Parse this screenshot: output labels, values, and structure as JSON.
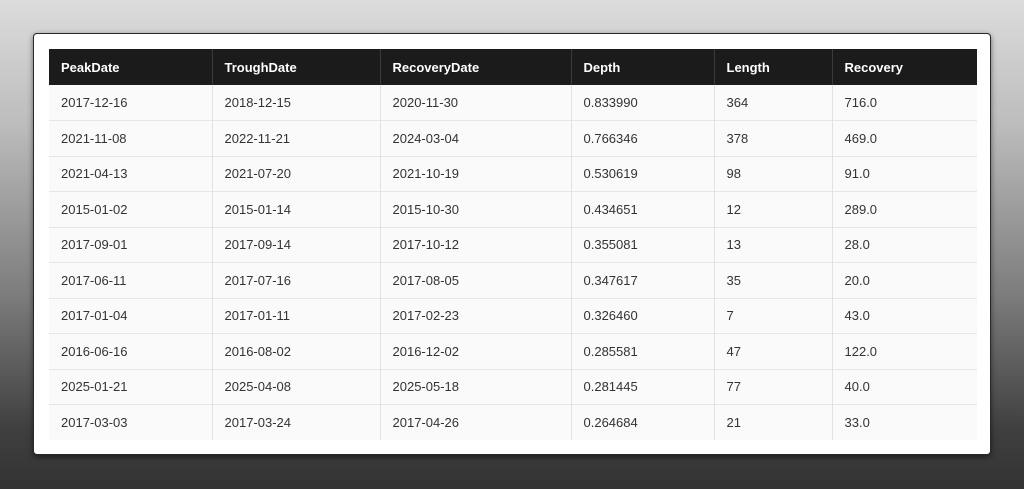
{
  "table": {
    "columns": [
      "PeakDate",
      "TroughDate",
      "RecoveryDate",
      "Depth",
      "Length",
      "Recovery"
    ],
    "rows": [
      [
        "2017-12-16",
        "2018-12-15",
        "2020-11-30",
        "0.833990",
        "364",
        "716.0"
      ],
      [
        "2021-11-08",
        "2022-11-21",
        "2024-03-04",
        "0.766346",
        "378",
        "469.0"
      ],
      [
        "2021-04-13",
        "2021-07-20",
        "2021-10-19",
        "0.530619",
        "98",
        "91.0"
      ],
      [
        "2015-01-02",
        "2015-01-14",
        "2015-10-30",
        "0.434651",
        "12",
        "289.0"
      ],
      [
        "2017-09-01",
        "2017-09-14",
        "2017-10-12",
        "0.355081",
        "13",
        "28.0"
      ],
      [
        "2017-06-11",
        "2017-07-16",
        "2017-08-05",
        "0.347617",
        "35",
        "20.0"
      ],
      [
        "2017-01-04",
        "2017-01-11",
        "2017-02-23",
        "0.326460",
        "7",
        "43.0"
      ],
      [
        "2016-06-16",
        "2016-08-02",
        "2016-12-02",
        "0.285581",
        "47",
        "122.0"
      ],
      [
        "2025-01-21",
        "2025-04-08",
        "2025-05-18",
        "0.281445",
        "77",
        "40.0"
      ],
      [
        "2017-03-03",
        "2017-03-24",
        "2017-04-26",
        "0.264684",
        "21",
        "33.0"
      ]
    ]
  }
}
